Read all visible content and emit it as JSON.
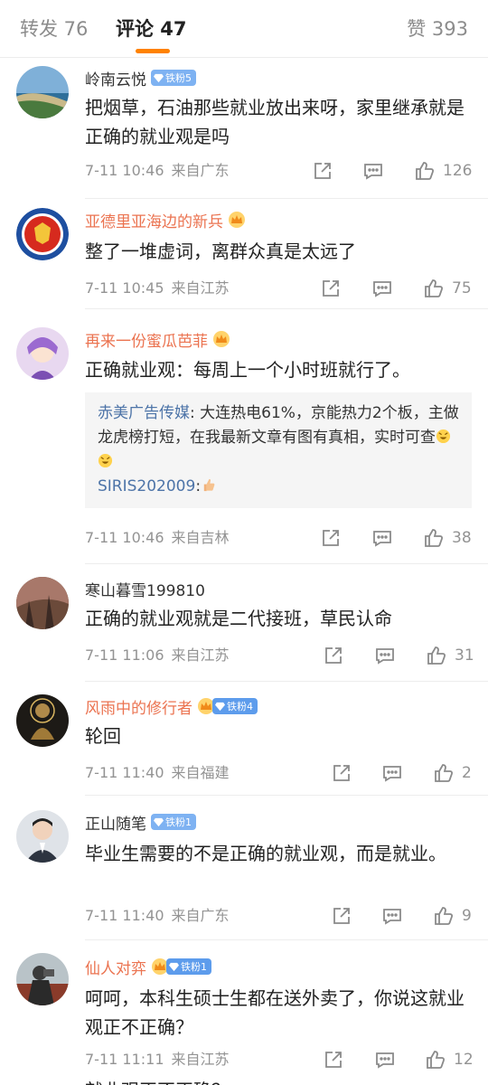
{
  "tabs": {
    "repost": "转发 76",
    "comments": "评论 47",
    "likes": "赞 393"
  },
  "colors": {
    "accent": "#ff8200",
    "vip_name": "#eb7350",
    "reply_name": "#4d74a8",
    "fan_badge": "#5d9cec",
    "meta_gray": "#939393"
  },
  "comments": [
    {
      "username": "岭南云悦",
      "fan_badge": "铁粉5",
      "vip": false,
      "text": "把烟草，石油那些就业放出来呀，家里继承就是正确的就业观是吗",
      "time": "7-11 10:46",
      "location": "来自广东",
      "likes": "126"
    },
    {
      "username": "亚德里亚海边的新兵",
      "fan_badge": "",
      "vip": true,
      "text": "整了一堆虚词，离群众真是太远了",
      "time": "7-11 10:45",
      "location": "来自江苏",
      "likes": "75"
    },
    {
      "username": "再来一份蜜瓜芭菲",
      "fan_badge": "",
      "vip": true,
      "text": "正确就业观：每周上一个小时班就行了。",
      "replies": [
        {
          "name": "赤美广告传媒",
          "text": ": 大连热电61%，京能热力2个板，主做龙虎榜打短，在我最新文章有图有真相，实时可查"
        },
        {
          "name": "SIRIS202009",
          "text": ":"
        }
      ],
      "time": "7-11 10:46",
      "location": "来自吉林",
      "likes": "38"
    },
    {
      "username": "寒山暮雪199810",
      "fan_badge": "",
      "vip": false,
      "text": "正确的就业观就是二代接班，草民认命",
      "time": "7-11 11:06",
      "location": "来自江苏",
      "likes": "31"
    },
    {
      "username": "风雨中的修行者",
      "fan_badge": "铁粉4",
      "vip": true,
      "text": "轮回",
      "time": "7-11 11:40",
      "location": "来自福建",
      "likes": "2"
    },
    {
      "username": "正山随笔",
      "fan_badge": "铁粉1",
      "vip": false,
      "text": "毕业生需要的不是正确的就业观，而是就业。",
      "time": "7-11 11:40",
      "location": "来自广东",
      "likes": "9"
    },
    {
      "username": "仙人对弈",
      "fan_badge": "铁粉1",
      "vip": true,
      "text": "呵呵，本科生硕士生都在送外卖了，你说这就业观正不正确？",
      "time": "7-11 11:11",
      "location": "来自江苏",
      "likes": "12"
    }
  ],
  "partial_next_text": "就业观正不正确？"
}
